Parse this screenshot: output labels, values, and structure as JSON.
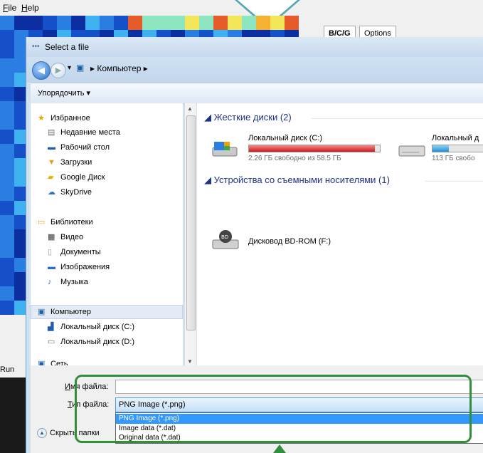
{
  "app": {
    "menu": [
      "File",
      "Help"
    ],
    "tabs": [
      "B/C/G",
      "Options"
    ],
    "run_label": "Run"
  },
  "dialog": {
    "title": "Select a file",
    "breadcrumb": "▸ Компьютер ▸",
    "toolbar": {
      "organize": "Упорядочить ▾"
    },
    "nav": {
      "favorites": "Избранное",
      "favorites_items": [
        "Недавние места",
        "Рабочий стол",
        "Загрузки",
        "Google Диск",
        "SkyDrive"
      ],
      "libraries": "Библиотеки",
      "libraries_items": [
        "Видео",
        "Документы",
        "Изображения",
        "Музыка"
      ],
      "computer": "Компьютер",
      "computer_items": [
        "Локальный диск (C:)",
        "Локальный диск (D:)"
      ],
      "network": "Сеть"
    },
    "content": {
      "hard_disks_header": "Жесткие диски (2)",
      "drives": [
        {
          "name": "Локальный диск (C:)",
          "free": "2.26 ГБ свободно из 58.5 ГБ",
          "usage": 0.96
        },
        {
          "name": "Локальный д",
          "free": "113 ГБ свобо",
          "usage": 0.3
        }
      ],
      "removable_header": "Устройства со съемными носителями (1)",
      "removable_items": [
        "Дисковод BD-ROM (F:)"
      ]
    },
    "form": {
      "filename_label": "Имя файла:",
      "filename_value": "",
      "filetype_label": "Тип файла:",
      "filetype_value": "PNG Image (*.png)",
      "filetype_options": [
        "PNG Image (*.png)",
        "Image data (*.dat)",
        "Original data (*.dat)"
      ],
      "hide_folders": "Скрыть папки"
    }
  },
  "colors": {
    "highlight": "#2f8f3a",
    "selection": "#3399ff"
  }
}
